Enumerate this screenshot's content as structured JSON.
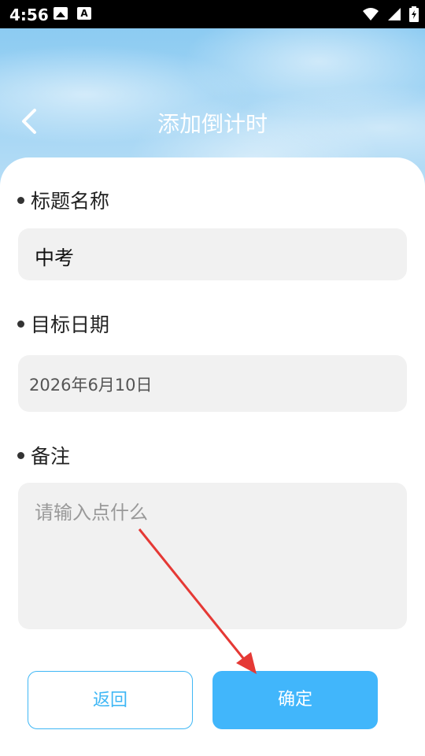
{
  "status_bar": {
    "time": "4:56",
    "icons": [
      "image-icon",
      "a-icon",
      "wifi-icon",
      "signal-icon",
      "battery-icon"
    ]
  },
  "header": {
    "title": "添加倒计时"
  },
  "form": {
    "title_label": "标题名称",
    "title_value": "中考",
    "date_label": "目标日期",
    "date_value": "2026年6月10日",
    "note_label": "备注",
    "note_placeholder": "请输入点什么"
  },
  "buttons": {
    "back": "返回",
    "confirm": "确定"
  },
  "colors": {
    "accent": "#41b6fb",
    "arrow": "#e53935"
  }
}
